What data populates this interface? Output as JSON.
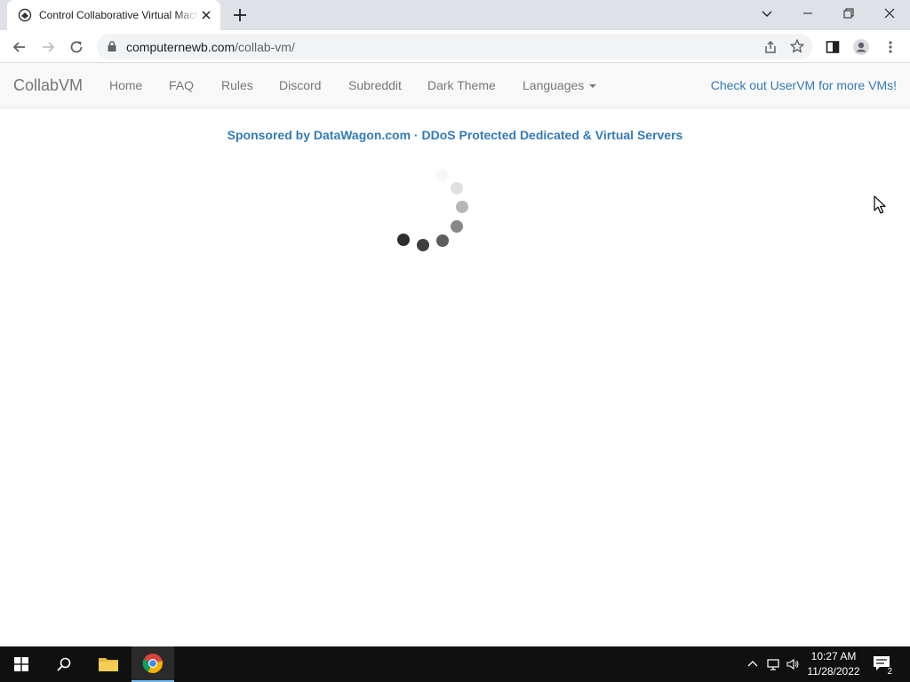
{
  "browser": {
    "tab_title": "Control Collaborative Virtual Machines!",
    "url_domain": "computernewb.com",
    "url_path": "/collab-vm/"
  },
  "site": {
    "brand": "CollabVM",
    "nav": {
      "home": "Home",
      "faq": "FAQ",
      "rules": "Rules",
      "discord": "Discord",
      "subreddit": "Subreddit",
      "dark_theme": "Dark Theme",
      "languages": "Languages"
    },
    "uservm_link": "Check out UserVM for more VMs!",
    "sponsor": "Sponsored by DataWagon.com · DDoS Protected Dedicated & Virtual Servers"
  },
  "taskbar": {
    "time": "10:27 AM",
    "date": "11/28/2022",
    "notification_count": "2"
  },
  "colors": {
    "link_blue": "#337ab7",
    "navbar_text": "#777777",
    "taskbar_bg": "#101010"
  }
}
